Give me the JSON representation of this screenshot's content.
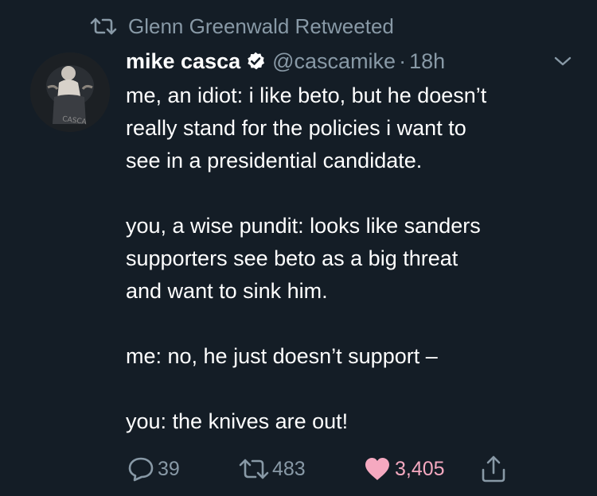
{
  "retweet_context": {
    "icon": "retweet-icon",
    "text": "Glenn Greenwald Retweeted"
  },
  "author": {
    "avatar": "avatar",
    "display_name": "mike casca",
    "verified_icon": "verified-badge-icon",
    "handle": "@cascamike",
    "separator": "·",
    "time_ago": "18h"
  },
  "menu": {
    "icon": "chevron-down-icon"
  },
  "tweet": {
    "paragraphs": [
      [
        "me, an idiot: i like beto, but he doesn’t",
        "really stand for the policies i want to",
        "see in a presidential candidate."
      ],
      [
        "you, a wise pundit: looks like sanders",
        "supporters see beto as a big threat",
        "and want to sink him."
      ],
      [
        "me: no, he just doesn’t support –"
      ],
      [
        "you: the knives are out!"
      ]
    ]
  },
  "actions": {
    "reply": {
      "icon": "reply-icon",
      "count": "39"
    },
    "retweet": {
      "icon": "retweet-icon",
      "count": "483"
    },
    "like": {
      "icon": "heart-icon",
      "count": "3,405",
      "color": "#e0245e"
    },
    "share": {
      "icon": "share-icon"
    }
  },
  "colors": {
    "background": "#141d26",
    "text": "#ffffff",
    "muted": "#8899a6",
    "like": "#e0245e",
    "verified": "#ffffff"
  }
}
